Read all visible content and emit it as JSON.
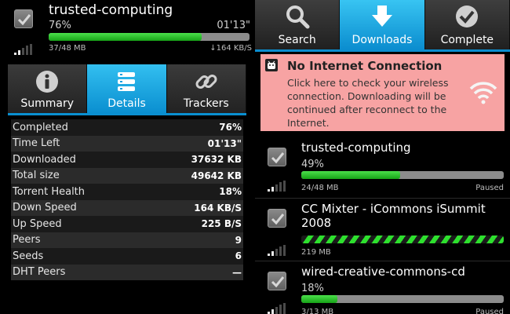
{
  "left": {
    "torrent": {
      "title": "trusted-computing",
      "percent_text": "76%",
      "time_text": "01'13\"",
      "progress": 0.76,
      "size_text": "37/48 MB",
      "speed_text": "↓164 KB/S"
    },
    "tabs": [
      {
        "label": "Summary",
        "icon": "info-icon",
        "active": false
      },
      {
        "label": "Details",
        "icon": "list-icon",
        "active": true
      },
      {
        "label": "Trackers",
        "icon": "chain-icon",
        "active": false
      }
    ],
    "details": [
      {
        "key": "Completed",
        "value": "76%"
      },
      {
        "key": "Time Left",
        "value": "01'13\""
      },
      {
        "key": "Downloaded",
        "value": "37632 KB"
      },
      {
        "key": "Total size",
        "value": "49642 KB"
      },
      {
        "key": "Torrent Health",
        "value": "18%"
      },
      {
        "key": "Down Speed",
        "value": "164 KB/S"
      },
      {
        "key": "Up Speed",
        "value": "225 B/S"
      },
      {
        "key": "Peers",
        "value": "9"
      },
      {
        "key": "Seeds",
        "value": "6"
      },
      {
        "key": "DHT Peers",
        "value": "—"
      }
    ]
  },
  "right": {
    "tabs": [
      {
        "label": "Search",
        "icon": "search-icon",
        "active": false
      },
      {
        "label": "Downloads",
        "icon": "download-arrow-icon",
        "active": true
      },
      {
        "label": "Complete",
        "icon": "checkmark-icon",
        "active": false
      }
    ],
    "alert": {
      "title": "No Internet Connection",
      "text": "Click here to check your wireless connection. Downloading will be continued after reconnect to the Internet.",
      "bg_color": "#f7a3a3"
    },
    "downloads": [
      {
        "title": "trusted-computing",
        "percent_text": "49%",
        "progress": 0.49,
        "size_text": "24/48 MB",
        "status": "Paused",
        "striped": false
      },
      {
        "title": "CC Mixter - iCommons iSummit 2008",
        "percent_text": "",
        "progress": 1.0,
        "size_text": "219 MB",
        "status": "",
        "striped": true
      },
      {
        "title": "wired-creative-commons-cd",
        "percent_text": "18%",
        "progress": 0.18,
        "size_text": "3/13 MB",
        "status": "Paused",
        "striped": false
      }
    ]
  },
  "colors": {
    "accent_blue": "#0b8dcf",
    "progress_green": "#22c022",
    "alert_pink": "#f7a3a3"
  }
}
